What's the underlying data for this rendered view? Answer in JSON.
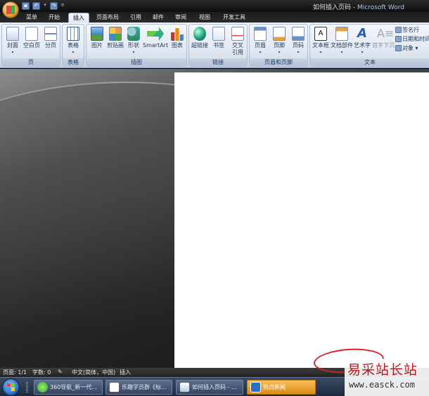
{
  "window": {
    "title_doc": "如何插入页码",
    "title_sep": " - ",
    "title_app": "Microsoft Word"
  },
  "tabs": [
    "菜单",
    "开始",
    "插入",
    "页面布局",
    "引用",
    "邮件",
    "审阅",
    "视图",
    "开发工具"
  ],
  "active_tab": "插入",
  "groups": {
    "pages": {
      "label": "页",
      "buttons": [
        "封面",
        "空白页",
        "分页"
      ]
    },
    "tables": {
      "label": "表格",
      "buttons": [
        "表格"
      ]
    },
    "illustrations": {
      "label": "插图",
      "buttons": [
        "图片",
        "剪贴画",
        "形状",
        "SmartArt",
        "图表"
      ]
    },
    "links": {
      "label": "链接",
      "buttons": [
        "超链接",
        "书签",
        "交叉引用"
      ]
    },
    "header_footer": {
      "label": "页眉和页脚",
      "buttons": [
        "页眉",
        "页脚",
        "页码"
      ]
    },
    "text": {
      "label": "文本",
      "buttons": [
        "文本框",
        "文档部件",
        "艺术字",
        "首字下沉"
      ],
      "small": [
        "签名行",
        "日期和时间",
        "对象"
      ]
    }
  },
  "status": {
    "page": "页面: 1/1",
    "words": "字数: 0",
    "language": "中文(简体，中国)",
    "mode": "插入"
  },
  "taskbar": {
    "items": [
      "360导航_新一代...",
      "乐趣学员群《标...",
      "如何插入页码 - ...",
      "热点新闻"
    ]
  },
  "watermark": {
    "text": "易采站长站",
    "url": "www.easck.com"
  },
  "colors": {
    "accent_red": "#d2232a",
    "ribbon_text": "#1e395b",
    "active_task": "#dd8a14"
  }
}
